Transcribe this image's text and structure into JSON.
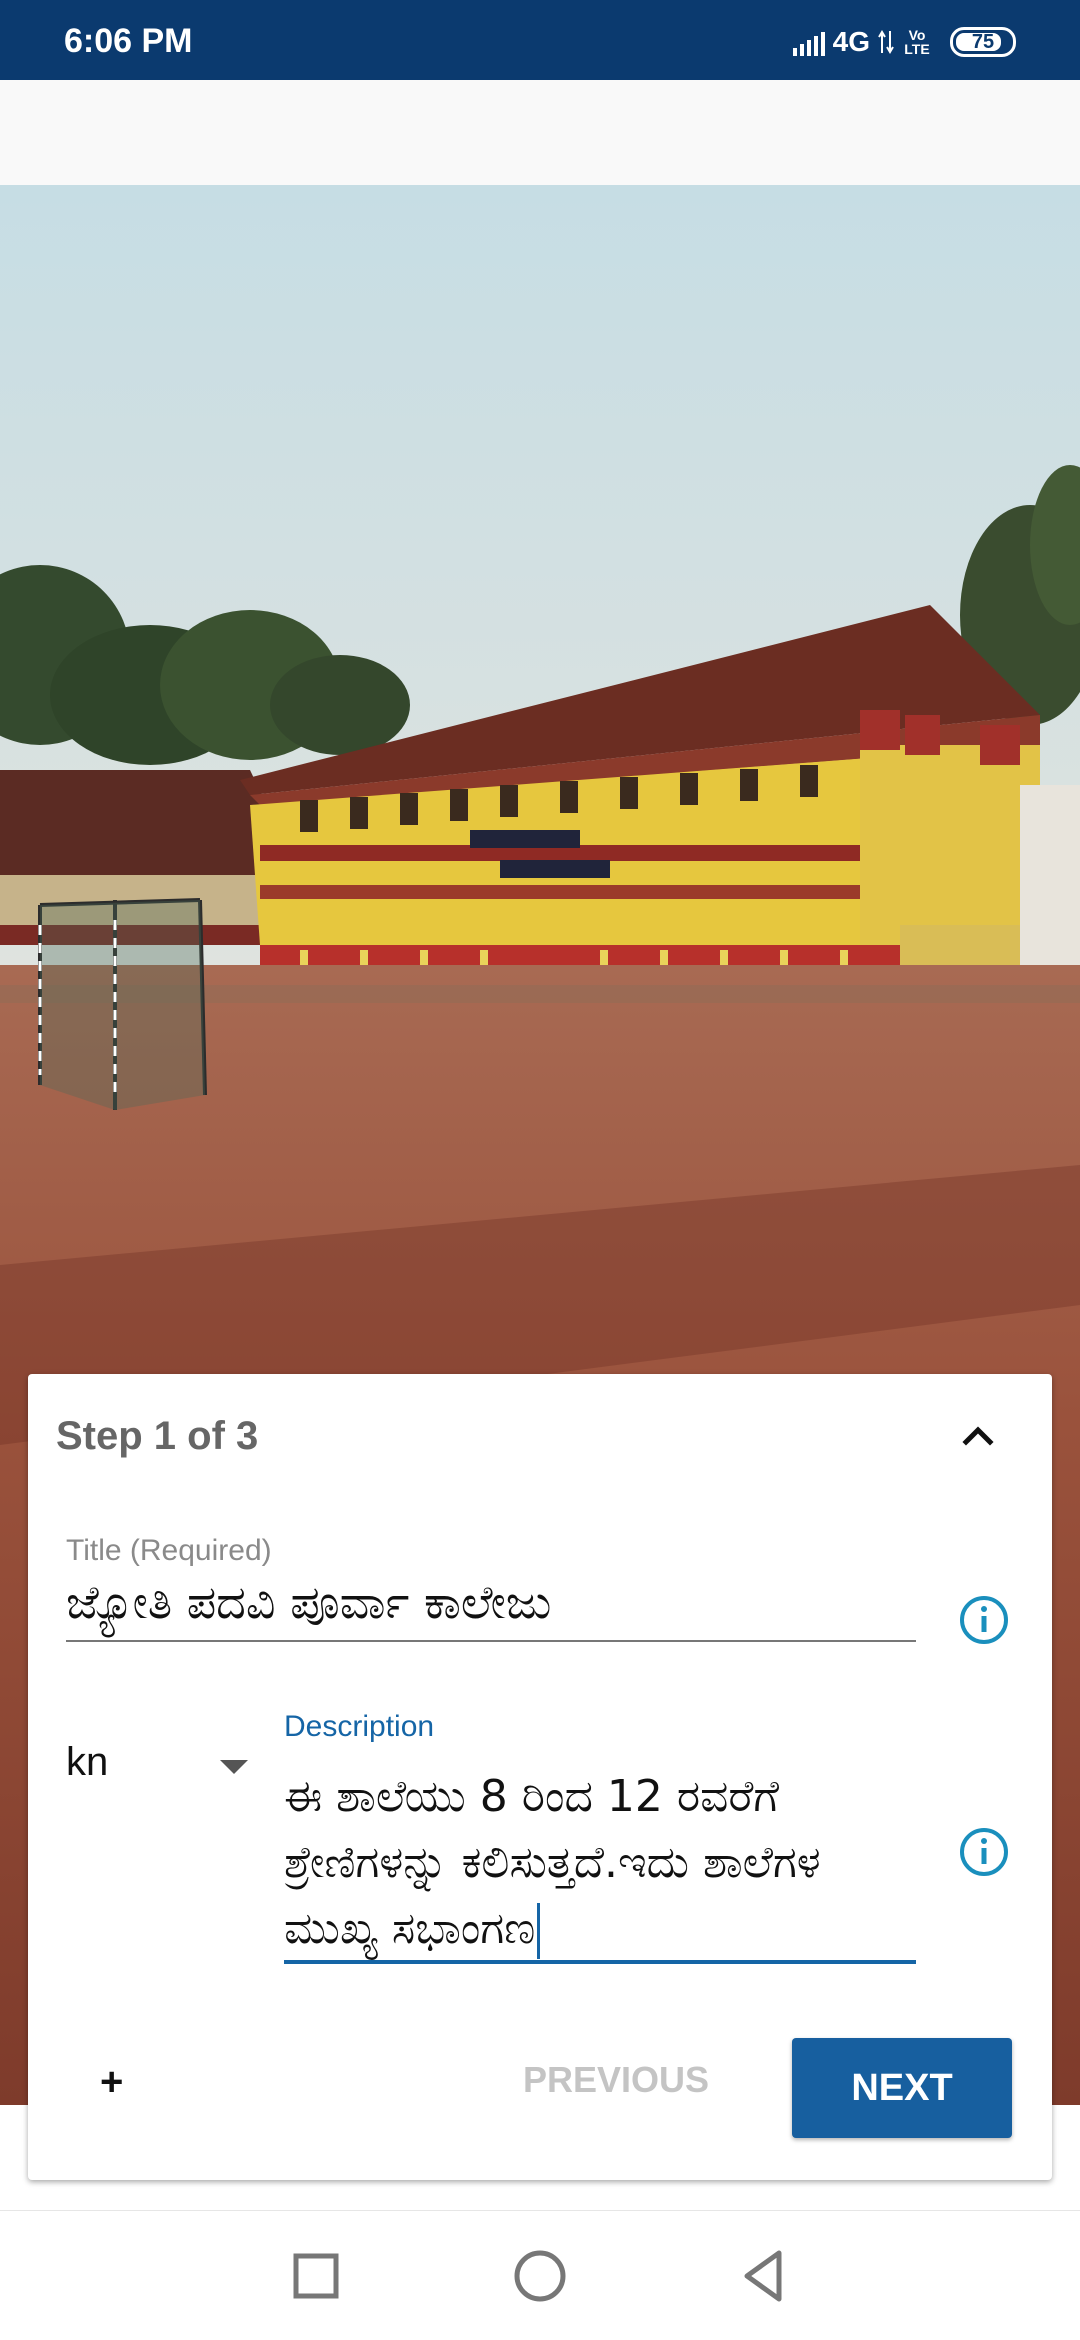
{
  "status_bar": {
    "time": "6:06 PM",
    "network": "4G",
    "volte": "Vo LTE",
    "battery": "75",
    "icons": [
      "signal-icon",
      "data-arrows-icon",
      "battery-icon"
    ]
  },
  "form": {
    "step": "Step 1 of 3",
    "title_label": "Title (Required)",
    "title_value": "ಜ್ಯೋತಿ ಪದವಿ ಪೂರ್ವಾ ಕಾಲೇಜು",
    "language": "kn",
    "description_label": "Description",
    "description_value": "ಈ ಶಾಲೆಯು 8 ರಿಂದ 12 ರವರೆಗೆ ಶ್ರೇಣಿಗಳನ್ನು ಕಲಿಸುತ್ತದೆ.ಇದು ಶಾಲೆಗಳ ಮುಖ್ಯ ಸಭಾಂಗಣ",
    "add_label": "+",
    "previous_label": "PREVIOUS",
    "next_label": "NEXT"
  },
  "colors": {
    "status_bar": "#0b3a6f",
    "accent": "#1565a6",
    "button": "#175f9f"
  },
  "nav": {
    "icons": [
      "recents-icon",
      "home-icon",
      "back-icon"
    ]
  }
}
